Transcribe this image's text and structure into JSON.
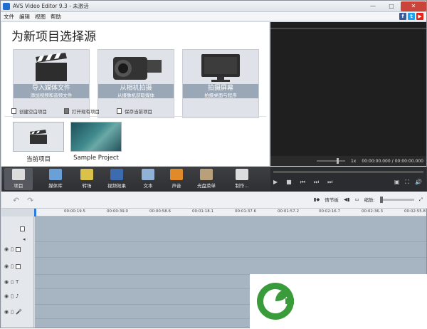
{
  "window": {
    "title": "AVS Video Editor 9.3 - 未激活",
    "minimize": "—",
    "maximize": "□",
    "close": "✕"
  },
  "menu": [
    "文件",
    "编辑",
    "视图",
    "帮助"
  ],
  "social": [
    "f",
    "t",
    "▶"
  ],
  "colors": {
    "accent": "#2a7be4",
    "toolbar": "#35373b",
    "track": "#a7b4c2",
    "facebook": "#3b5998",
    "twitter": "#1da1f2",
    "youtube": "#e62117",
    "logo_green": "#3a9b3a"
  },
  "start": {
    "heading": "为新项目选择源",
    "cards": [
      {
        "title": "导入媒体文件",
        "subtitle": "添加视频和音频文件",
        "icon": "clapperboard-icon"
      },
      {
        "title": "从相机拍摄",
        "subtitle": "从摄像机获取媒体",
        "icon": "camcorder-icon"
      },
      {
        "title": "拍摄屏幕",
        "subtitle": "拍摄桌面与程序",
        "icon": "monitor-icon"
      }
    ],
    "actions": [
      "创建空白项目",
      "打开现有项目",
      "保存当前项目"
    ],
    "projects": [
      {
        "label": "当前项目",
        "icon": "clapperboard-icon"
      },
      {
        "label": "Sample Project",
        "icon": "underwater-thumbnail"
      }
    ]
  },
  "preview": {
    "speed": "1x",
    "time_current": "00:00:00.000",
    "time_sep": "/",
    "time_total": "00:00:00.000"
  },
  "toolbar": [
    {
      "label": "项目",
      "icon": "clapperboard-icon",
      "active": true
    },
    {
      "label": "媒体库",
      "icon": "film-library-icon"
    },
    {
      "label": "转场",
      "icon": "transition-icon"
    },
    {
      "label": "视频效果",
      "icon": "star-effect-icon"
    },
    {
      "label": "文本",
      "icon": "text-icon"
    },
    {
      "label": "声音",
      "icon": "microphone-icon"
    },
    {
      "label": "光盘菜单",
      "icon": "disc-menu-icon"
    },
    {
      "label": "制作...",
      "icon": "produce-icon"
    }
  ],
  "player": {
    "play": "▶",
    "stop": "■",
    "prev": "⏮",
    "next": "⏭",
    "frame": "⏭"
  },
  "timeline_bar": {
    "storyboard": "情节板",
    "zoom_label": "缩放:"
  },
  "ruler": [
    "00:00:19.5",
    "00:00:39.0",
    "00:00:58.6",
    "00:01:18.1",
    "00:01:37.6",
    "00:01:57.2",
    "00:02:16.7",
    "00:02:36.3",
    "00:02:55.8"
  ]
}
